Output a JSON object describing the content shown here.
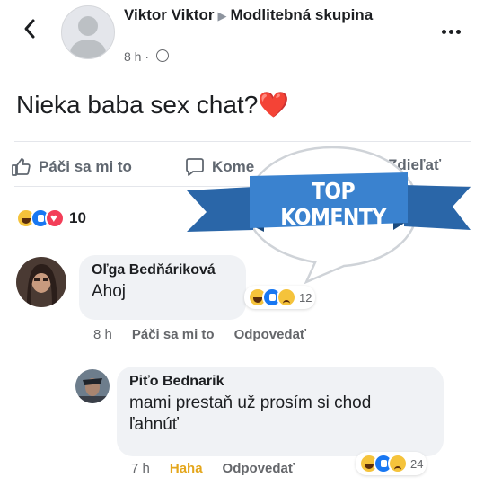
{
  "header": {
    "author": "Viktor Viktor",
    "group": "Modlitebná skupina",
    "time": "8 h ·",
    "back_icon": "chevron-left-icon",
    "more_icon": "more-horizontal-icon"
  },
  "post": {
    "text": "Nieka baba sex chat?❤️"
  },
  "actions": {
    "like": "Páči sa mi to",
    "comment": "Kome",
    "share": "Zdieľať"
  },
  "reactions": {
    "count": "10",
    "types": [
      "haha",
      "like",
      "love"
    ]
  },
  "overlay": {
    "banner": "TOP KOMENTY",
    "color": "#2f78c4"
  },
  "comments": [
    {
      "name": "Oľga Bedňáriková",
      "text": "Ahoj",
      "time": "8 h",
      "like": "Páči sa mi to",
      "reply": "Odpovedať",
      "reaction_count": "12",
      "reactions": [
        "haha",
        "like",
        "sad"
      ]
    },
    {
      "name": "Piťo Bednarik",
      "text_line1": "mami prestaň už prosím si chod",
      "text_line2": "ľahnúť",
      "time": "7 h",
      "reaction_label": "Haha",
      "reply": "Odpovedať",
      "reaction_count": "24",
      "reactions": [
        "haha",
        "like",
        "sad"
      ]
    }
  ]
}
